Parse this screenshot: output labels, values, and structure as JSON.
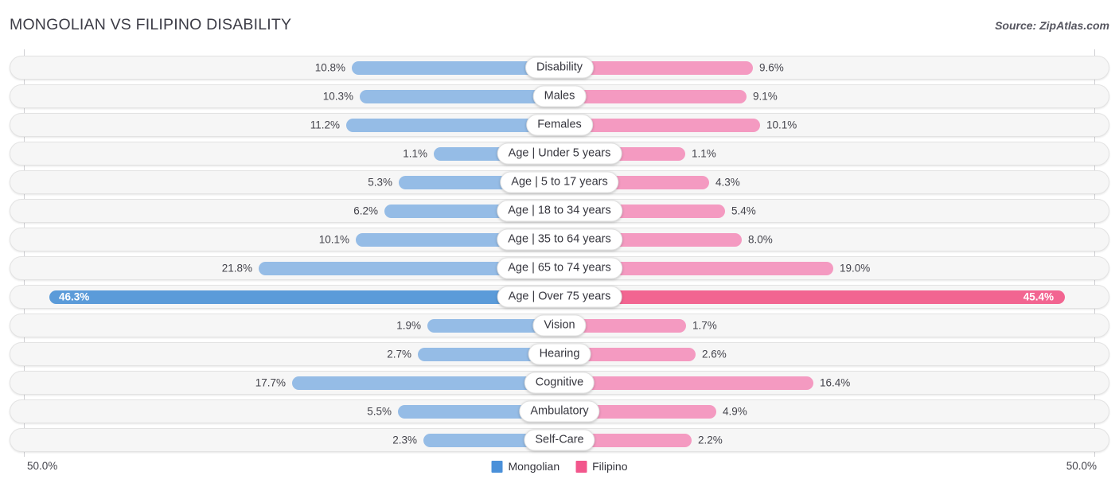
{
  "header": {
    "title": "MONGOLIAN VS FILIPINO DISABILITY",
    "source": "Source: ZipAtlas.com"
  },
  "axis": {
    "left_label": "50.0%",
    "right_label": "50.0%"
  },
  "legend": [
    {
      "label": "Mongolian",
      "color": "#4a90d9"
    },
    {
      "label": "Filipino",
      "color": "#f2568c"
    }
  ],
  "colors": {
    "left_bar": "#95bce6",
    "right_bar": "#f49ac1",
    "left_bar_highlight": "#5b9bd9",
    "right_bar_highlight": "#f26591",
    "track": "#f6f6f6",
    "text": "#44444c"
  },
  "chart_data": {
    "type": "bar",
    "title": "MONGOLIAN VS FILIPINO DISABILITY",
    "subtitle": "",
    "xlabel": "",
    "ylabel": "",
    "orientation": "horizontal-diverging",
    "axis_max_percent": 50.0,
    "grid": false,
    "legend_position": "bottom-center",
    "categories": [
      "Disability",
      "Males",
      "Females",
      "Age | Under 5 years",
      "Age | 5 to 17 years",
      "Age | 18 to 34 years",
      "Age | 35 to 64 years",
      "Age | 65 to 74 years",
      "Age | Over 75 years",
      "Vision",
      "Hearing",
      "Cognitive",
      "Ambulatory",
      "Self-Care"
    ],
    "series": [
      {
        "name": "Mongolian",
        "side": "left",
        "values": [
          10.8,
          10.3,
          11.2,
          1.1,
          5.3,
          6.2,
          10.1,
          21.8,
          46.3,
          1.9,
          2.7,
          17.7,
          5.5,
          2.3
        ],
        "labels": [
          "10.8%",
          "10.3%",
          "11.2%",
          "1.1%",
          "5.3%",
          "6.2%",
          "10.1%",
          "21.8%",
          "46.3%",
          "1.9%",
          "2.7%",
          "17.7%",
          "5.5%",
          "2.3%"
        ]
      },
      {
        "name": "Filipino",
        "side": "right",
        "values": [
          9.6,
          9.1,
          10.1,
          1.1,
          4.3,
          5.4,
          8.0,
          19.0,
          45.4,
          1.7,
          2.6,
          16.4,
          4.9,
          2.2
        ],
        "labels": [
          "9.6%",
          "9.1%",
          "10.1%",
          "1.1%",
          "4.3%",
          "5.4%",
          "8.0%",
          "19.0%",
          "45.4%",
          "1.7%",
          "2.6%",
          "16.4%",
          "4.9%",
          "2.2%"
        ]
      }
    ],
    "highlighted_rows": [
      "Age | Over 75 years"
    ]
  },
  "geometry": {
    "center_x": 703,
    "left_bar_ends": [
      442,
      452,
      435,
      545,
      501,
      483,
      447,
      325,
      62,
      537,
      525,
      367,
      500,
      532
    ],
    "right_bar_ends": [
      946,
      938,
      955,
      861,
      891,
      911,
      932,
      1047,
      1338,
      862,
      874,
      1022,
      900,
      869
    ],
    "row_tops": [
      8,
      44,
      80,
      116,
      152,
      188,
      224,
      260,
      296,
      332,
      368,
      404,
      440,
      476
    ]
  }
}
